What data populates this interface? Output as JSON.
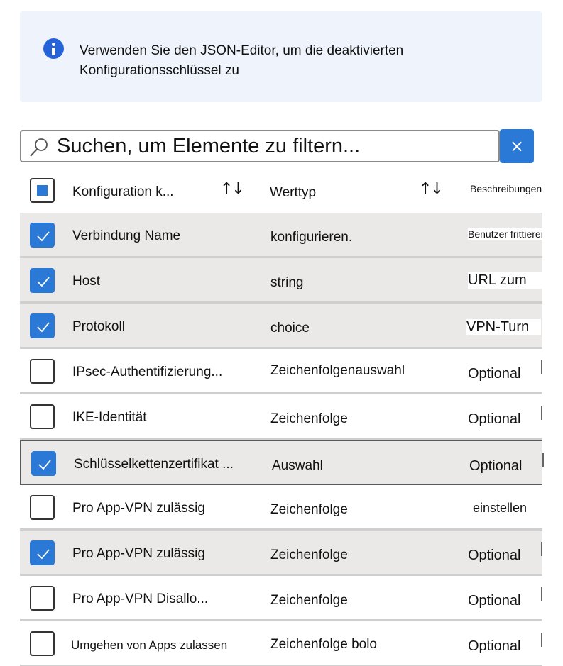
{
  "banner": {
    "icon": "info-icon",
    "message": "Verwenden Sie den JSON-Editor, um die deaktivierten Konfigurationsschlüssel zu"
  },
  "search": {
    "placeholder": "Suchen, um Elemente zu filtern...",
    "value": "",
    "icon": "search-icon",
    "clear_label": "×"
  },
  "table": {
    "select_all_state": "indeterminate",
    "columns": [
      {
        "label": "Konfiguration k...",
        "sortable": true
      },
      {
        "label": "Werttyp",
        "sortable": true
      },
      {
        "label": "Beschreibungen",
        "sortable": false
      }
    ],
    "sort_icon": "↑↓",
    "rows": [
      {
        "name": "Verbindung   Name",
        "type": "konfigurieren.",
        "description": "Benutzer frittieren",
        "checked": true
      },
      {
        "name": "Host",
        "type": "string",
        "description": "URL zum",
        "checked": true
      },
      {
        "name": "Protokoll",
        "type": "choice",
        "description": "VPN-Turn",
        "checked": true
      },
      {
        "name": "IPsec-Authentifizierung...",
        "type": "Zeichenfolgenauswahl",
        "description": "Optional",
        "checked": false
      },
      {
        "name": "IKE-Identität",
        "type": "Zeichenfolge",
        "description": "Optional",
        "checked": false
      },
      {
        "name": "Schlüsselkettenzertifikat ...",
        "type": "Auswahl",
        "description": "Optional",
        "checked": true
      },
      {
        "name": "Pro App-VPN zulässig",
        "type": "Zeichenfolge",
        "description": "einstellen",
        "checked": false
      },
      {
        "name": "Pro App-VPN zulässig",
        "type": "Zeichenfolge",
        "description": "Optional",
        "checked": true
      },
      {
        "name": "Pro App-VPN   Disallo...",
        "type": "Zeichenfolge",
        "description": "Optional",
        "checked": false
      },
      {
        "name": "Umgehen von Apps zulassen",
        "type": "Zeichenfolge bolo",
        "description": "Optional",
        "checked": false
      }
    ]
  },
  "colors": {
    "accent": "#2b79d6",
    "banner_bg": "#eff4fc",
    "info_icon": "#2563d8",
    "selected_row": "#ebe9e8"
  }
}
